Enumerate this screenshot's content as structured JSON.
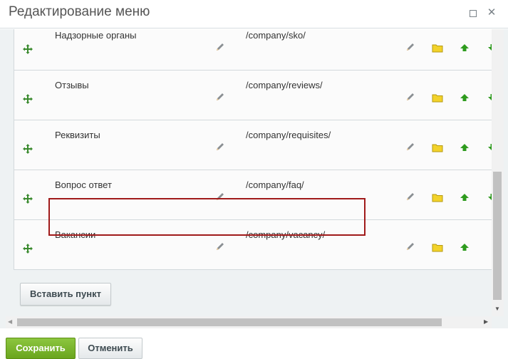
{
  "dialog": {
    "title": "Редактирование меню"
  },
  "items": [
    {
      "name": "Надзорные органы",
      "link": "/company/sko/"
    },
    {
      "name": "Отзывы",
      "link": "/company/reviews/"
    },
    {
      "name": "Реквизиты",
      "link": "/company/requisites/"
    },
    {
      "name": "Вопрос ответ",
      "link": "/company/faq/"
    },
    {
      "name": "Вакансии",
      "link": "/company/vacancy/"
    }
  ],
  "actions": {
    "insert_label": "Вставить пункт"
  },
  "footer": {
    "save_label": "Сохранить",
    "cancel_label": "Отменить"
  },
  "icons": {
    "move": "move-arrows-icon",
    "edit": "pencil-icon",
    "folder": "folder-icon",
    "up": "arrow-up-icon",
    "down": "arrow-down-icon"
  },
  "colors": {
    "highlight_border": "#a01a1a",
    "save_button": "#7ab82c",
    "arrow_green": "#2e9b1e",
    "folder_yellow": "#f2d22a"
  }
}
